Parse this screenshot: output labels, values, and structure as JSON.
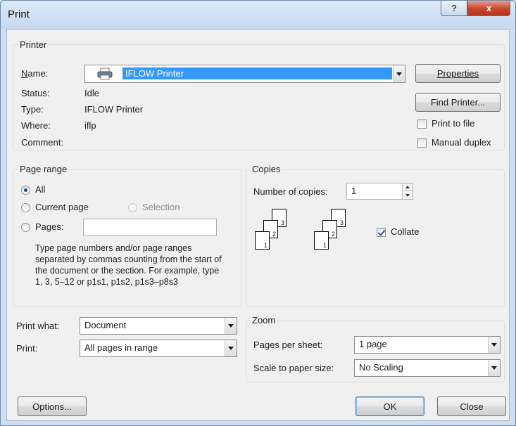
{
  "window": {
    "title": "Print",
    "help_glyph": "?",
    "close_glyph": "x"
  },
  "printer": {
    "group_label": "Printer",
    "name_label": "Name:",
    "name_value": "IFLOW Printer",
    "status_label": "Status:",
    "status_value": "Idle",
    "type_label": "Type:",
    "type_value": "IFLOW Printer",
    "where_label": "Where:",
    "where_value": "iflp",
    "comment_label": "Comment:",
    "properties_button": "Properties",
    "find_printer_button": "Find Printer...",
    "print_to_file_label": "Print to file",
    "manual_duplex_label": "Manual duplex",
    "print_to_file_checked": false,
    "manual_duplex_checked": false
  },
  "page_range": {
    "group_label": "Page range",
    "all_label": "All",
    "current_page_label": "Current page",
    "selection_label": "Selection",
    "pages_label": "Pages:",
    "pages_value": "",
    "help_text": "Type page numbers and/or page ranges separated by commas counting from the start of the document or the section. For example, type 1, 3, 5–12 or p1s1, p1s2, p1s3–p8s3",
    "selected": "all"
  },
  "copies": {
    "group_label": "Copies",
    "number_label": "Number of copies:",
    "number_value": "1",
    "collate_label": "Collate",
    "collate_checked": true,
    "stack_numbers": [
      "3",
      "2",
      "1"
    ]
  },
  "print_what": {
    "label": "Print what:",
    "value": "Document"
  },
  "print": {
    "label": "Print:",
    "value": "All pages in range"
  },
  "zoom": {
    "group_label": "Zoom",
    "pages_per_sheet_label": "Pages per sheet:",
    "pages_per_sheet_value": "1 page",
    "scale_label": "Scale to paper size:",
    "scale_value": "No Scaling"
  },
  "footer": {
    "options_button": "Options...",
    "ok_button": "OK",
    "close_button": "Close"
  },
  "colors": {
    "selection_bg": "#3399ff",
    "titlebar": "#c6d9ee",
    "close_button": "#c7452c"
  }
}
